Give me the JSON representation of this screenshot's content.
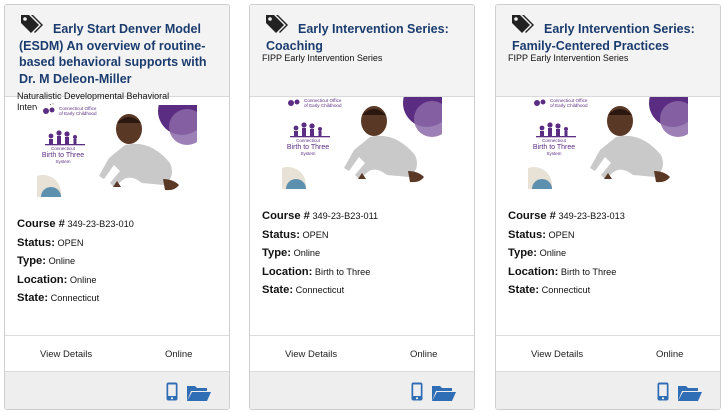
{
  "labels": {
    "course": "Course #",
    "status": "Status:",
    "type": "Type:",
    "location": "Location:",
    "state": "State:"
  },
  "colors": {
    "title_blue": "#1b3c6e",
    "icon_blue": "#2f6db5",
    "purple": "#5b2d82"
  },
  "image": {
    "org_line1": "Connecticut Office",
    "org_line2": "of Early Childhood",
    "logo_line1": "Connecticut",
    "logo_line2": "Birth to Three",
    "logo_line3": "System"
  },
  "cards": [
    {
      "title_lines": [
        "Early Start Denver Model",
        "(ESDM) An overview of routine-",
        "based behavioral supports with",
        "Dr. M Deleon-Miller"
      ],
      "subtitle_lines": [
        "Naturalistic Developmental Behavioral",
        "Intervention"
      ],
      "course": "349-23-B23-010",
      "status": "OPEN",
      "type": "Online",
      "location": "Online",
      "state": "Connecticut",
      "view_details": "View Details",
      "delivery": "Online"
    },
    {
      "title_lines": [
        "Early Intervention Series:",
        "Coaching"
      ],
      "subtitle_lines": [
        "FIPP Early Intervention Series"
      ],
      "course": "349-23-B23-011",
      "status": "OPEN",
      "type": "Online",
      "location": "Birth to Three",
      "state": "Connecticut",
      "view_details": "View Details",
      "delivery": "Online"
    },
    {
      "title_lines": [
        "Early Intervention Series:",
        "Family-Centered Practices"
      ],
      "subtitle_lines": [
        "FIPP Early Intervention Series"
      ],
      "course": "349-23-B23-013",
      "status": "OPEN",
      "type": "Online",
      "location": "Birth to Three",
      "state": "Connecticut",
      "view_details": "View Details",
      "delivery": "Online"
    }
  ]
}
